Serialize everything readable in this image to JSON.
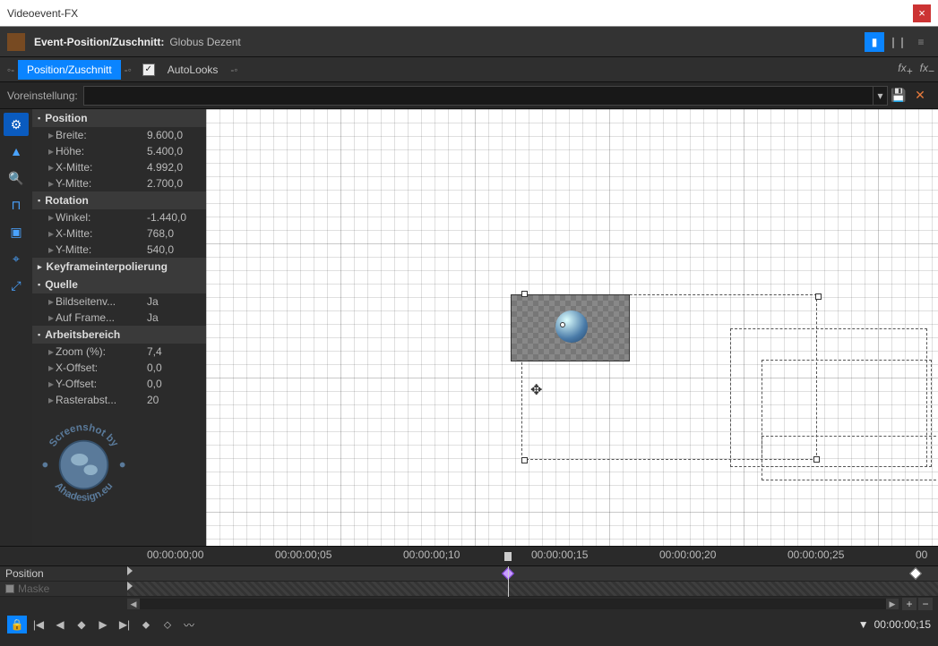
{
  "window": {
    "title": "Videoevent-FX"
  },
  "header": {
    "title": "Event-Position/Zuschnitt:",
    "subtitle": "Globus Dezent"
  },
  "tabs": {
    "position": "Position/Zuschnitt",
    "autolooks": "AutoLooks"
  },
  "preset": {
    "label": "Voreinstellung:"
  },
  "props": {
    "position": {
      "title": "Position",
      "breite": {
        "label": "Breite:",
        "value": "9.600,0"
      },
      "hoehe": {
        "label": "Höhe:",
        "value": "5.400,0"
      },
      "xmitte": {
        "label": "X-Mitte:",
        "value": "4.992,0"
      },
      "ymitte": {
        "label": "Y-Mitte:",
        "value": "2.700,0"
      }
    },
    "rotation": {
      "title": "Rotation",
      "winkel": {
        "label": "Winkel:",
        "value": "-1.440,0"
      },
      "xmitte": {
        "label": "X-Mitte:",
        "value": "768,0"
      },
      "ymitte": {
        "label": "Y-Mitte:",
        "value": "540,0"
      }
    },
    "keyframe": {
      "title": "Keyframeinterpolierung"
    },
    "quelle": {
      "title": "Quelle",
      "bildseiten": {
        "label": "Bildseitenv...",
        "value": "Ja"
      },
      "aufframe": {
        "label": "Auf Frame...",
        "value": "Ja"
      }
    },
    "arbeitsbereich": {
      "title": "Arbeitsbereich",
      "zoom": {
        "label": "Zoom (%):",
        "value": "7,4"
      },
      "xoffset": {
        "label": "X-Offset:",
        "value": "0,0"
      },
      "yoffset": {
        "label": "Y-Offset:",
        "value": "0,0"
      },
      "raster": {
        "label": "Rasterabst...",
        "value": "20"
      }
    }
  },
  "watermark": {
    "text_top": "Screenshot by",
    "text_bottom": "Ahadesign.eu"
  },
  "timeline": {
    "ticks": [
      "00:00:00;00",
      "00:00:00;05",
      "00:00:00;10",
      "00:00:00;15",
      "00:00:00;20",
      "00:00:00;25",
      "00"
    ],
    "tracks": {
      "position": "Position",
      "maske": "Maske"
    },
    "current_time": "00:00:00;15"
  }
}
